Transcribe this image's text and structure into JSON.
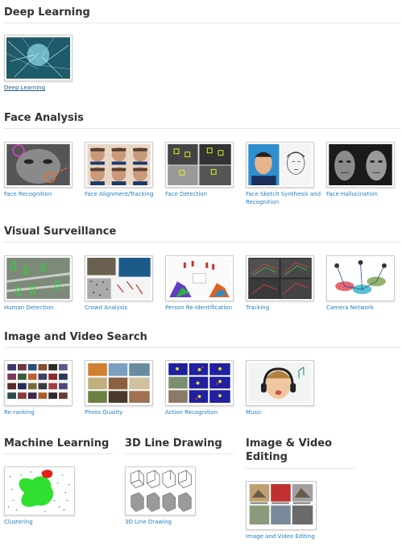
{
  "sections": {
    "deep_learning": {
      "title": "Deep Learning",
      "items": [
        "Deep Learning"
      ]
    },
    "face_analysis": {
      "title": "Face Analysis",
      "items": [
        "Face Recognition",
        "Face Alignment/Tracking",
        "Face Detection",
        "Face Sketch Synthesis and Recognition",
        "Face Hallucination"
      ]
    },
    "visual_surveillance": {
      "title": "Visual Surveillance",
      "items": [
        "Human Detection",
        "Crowd Analysis",
        "Person Re-Identification",
        "Tracking",
        "Camera Network"
      ]
    },
    "image_video_search": {
      "title": "Image and Video Search",
      "items": [
        "Re-ranking",
        "Photo Quality",
        "Action Recognition",
        "Music"
      ]
    },
    "machine_learning": {
      "title": "Machine Learning",
      "items": [
        "Clustering"
      ]
    },
    "line_drawing": {
      "title": "3D Line Drawing",
      "items": [
        "3D Line Drawing"
      ]
    },
    "image_video_editing": {
      "title": "Image & Video Editing",
      "items": [
        "Image and Video Editing"
      ]
    }
  },
  "colors": {
    "link": "#1f7fc0",
    "heading": "#333333",
    "rule": "#e6e6e6"
  }
}
